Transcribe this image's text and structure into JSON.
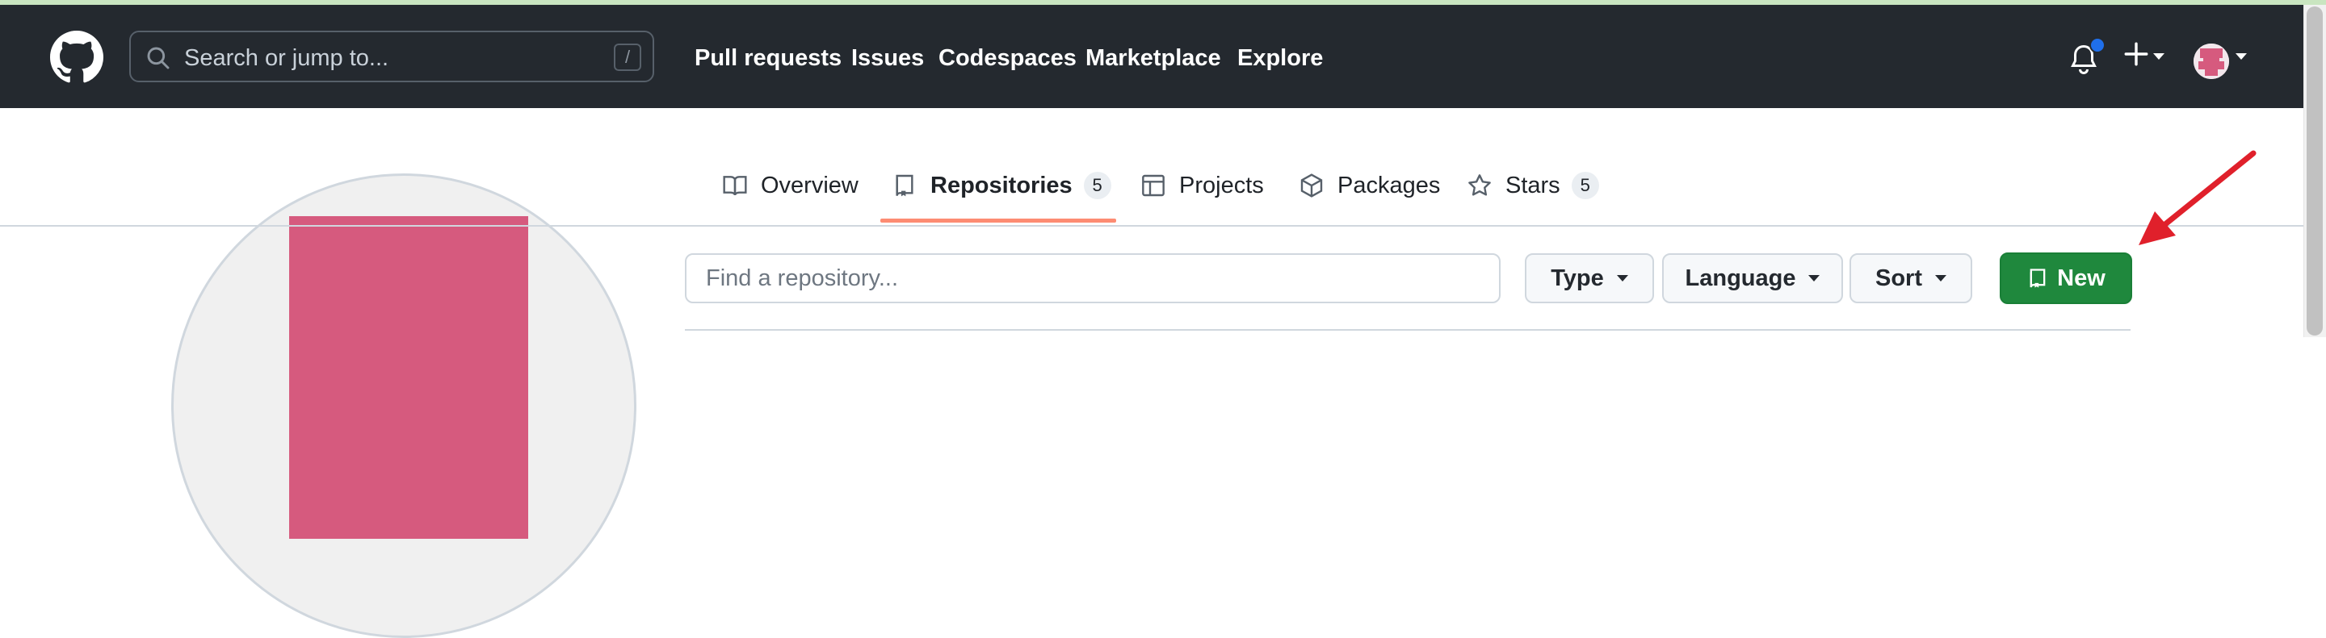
{
  "header": {
    "search_placeholder": "Search or jump to...",
    "search_shortcut": "/",
    "nav": [
      "Pull requests",
      "Issues",
      "Codespaces",
      "Marketplace",
      "Explore"
    ]
  },
  "profile_tabs": [
    {
      "label": "Overview"
    },
    {
      "label": "Repositories",
      "count": "5",
      "selected": true
    },
    {
      "label": "Projects"
    },
    {
      "label": "Packages"
    },
    {
      "label": "Stars",
      "count": "5"
    }
  ],
  "repo_filter": {
    "placeholder": "Find a repository...",
    "type_label": "Type",
    "language_label": "Language",
    "sort_label": "Sort",
    "new_label": "New"
  },
  "colors": {
    "header_bg": "#24292f",
    "new_button": "#1f883d",
    "tab_underline": "#fd8c73",
    "annotation_arrow": "#e0202b"
  }
}
